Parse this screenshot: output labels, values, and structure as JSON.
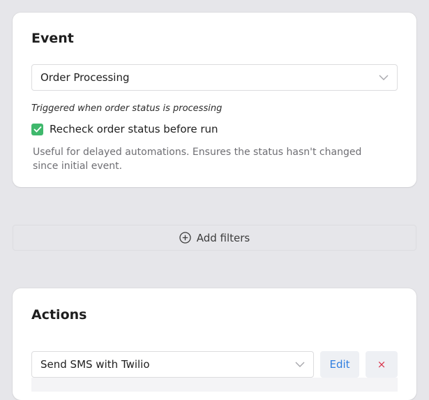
{
  "event": {
    "title": "Event",
    "select_value": "Order Processing",
    "hint": "Triggered when order status is processing",
    "recheck_label": "Recheck order status before run",
    "recheck_checked": true,
    "description": "Useful for delayed automations. Ensures the status hasn't changed since initial event."
  },
  "filters": {
    "add_label": "Add filters"
  },
  "actions": {
    "title": "Actions",
    "select_value": "Send SMS with Twilio",
    "edit_label": "Edit",
    "delete_label": "×"
  },
  "colors": {
    "checkbox": "#3fb86c",
    "edit_text": "#2f7ee0",
    "delete_text": "#d9364d",
    "page_bg": "#e6e6ea"
  },
  "icons": {
    "chevron": "chevron-down-icon",
    "add": "plus-circle-icon",
    "check": "check-icon"
  }
}
